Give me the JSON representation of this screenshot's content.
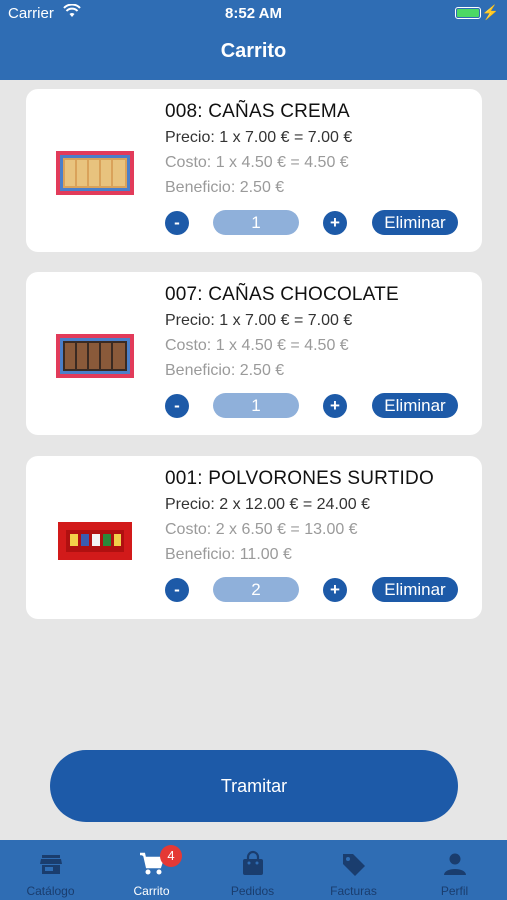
{
  "status_bar": {
    "carrier": "Carrier",
    "time": "8:52 AM"
  },
  "header": {
    "title": "Carrito"
  },
  "cart": {
    "items": [
      {
        "name": "008: CAÑAS CREMA",
        "price": "Precio: 1 x 7.00 € = 7.00 €",
        "cost": "Costo: 1 x 4.50 € = 4.50 €",
        "profit": "Beneficio: 2.50 €",
        "quantity": "1",
        "minus": "-",
        "plus": "+",
        "remove": "Eliminar"
      },
      {
        "name": "007: CAÑAS CHOCOLATE",
        "price": "Precio: 1 x 7.00 € = 7.00 €",
        "cost": "Costo: 1 x 4.50 € = 4.50 €",
        "profit": "Beneficio: 2.50 €",
        "quantity": "1",
        "minus": "-",
        "plus": "+",
        "remove": "Eliminar"
      },
      {
        "name": "001: POLVORONES SURTIDO",
        "price": "Precio: 2 x 12.00 € = 24.00 €",
        "cost": "Costo: 2 x 6.50 € = 13.00 €",
        "profit": "Beneficio: 11.00 €",
        "quantity": "2",
        "minus": "-",
        "plus": "+",
        "remove": "Eliminar"
      }
    ],
    "checkout_label": "Tramitar"
  },
  "tab_bar": {
    "items": [
      {
        "label": "Catálogo",
        "icon": "store-icon"
      },
      {
        "label": "Carrito",
        "icon": "cart-icon",
        "badge": "4"
      },
      {
        "label": "Pedidos",
        "icon": "bag-icon"
      },
      {
        "label": "Facturas",
        "icon": "tag-icon"
      },
      {
        "label": "Perfil",
        "icon": "person-icon"
      }
    ],
    "active": "Carrito"
  },
  "colors": {
    "header": "#2f6db4",
    "accent": "#1d5aa8",
    "qty_field": "#8fb0da",
    "badge": "#e53935",
    "background": "#e6e6e6"
  }
}
